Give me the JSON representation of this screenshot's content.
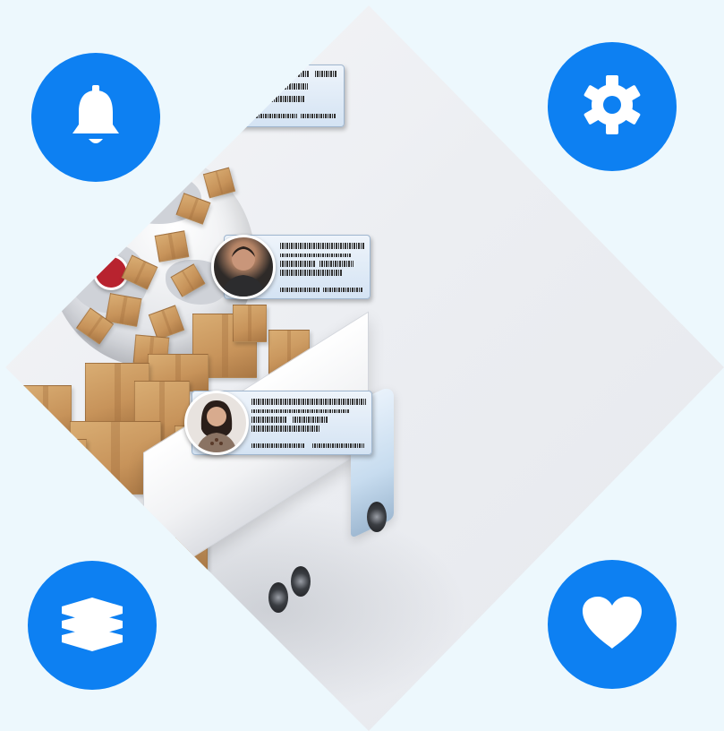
{
  "colors": {
    "background": "#edf8fd",
    "icon_circle": "#0d80f2",
    "icon_glyph": "#ffffff",
    "box_cardboard": "#c7935a",
    "id_card": "#d4e3f3"
  },
  "feature_icons": [
    {
      "name": "bell-icon",
      "position": "top-left"
    },
    {
      "name": "gear-icon",
      "position": "top-right"
    },
    {
      "name": "layers-icon",
      "position": "bottom-left"
    },
    {
      "name": "heart-icon",
      "position": "bottom-right"
    }
  ],
  "illustration": {
    "shape": "diamond",
    "elements": [
      "globe",
      "cardboard-boxes",
      "delivery-truck",
      "id-cards"
    ],
    "id_cards": [
      {
        "photo": "partial"
      },
      {
        "photo": "man"
      },
      {
        "photo": "woman"
      }
    ]
  }
}
